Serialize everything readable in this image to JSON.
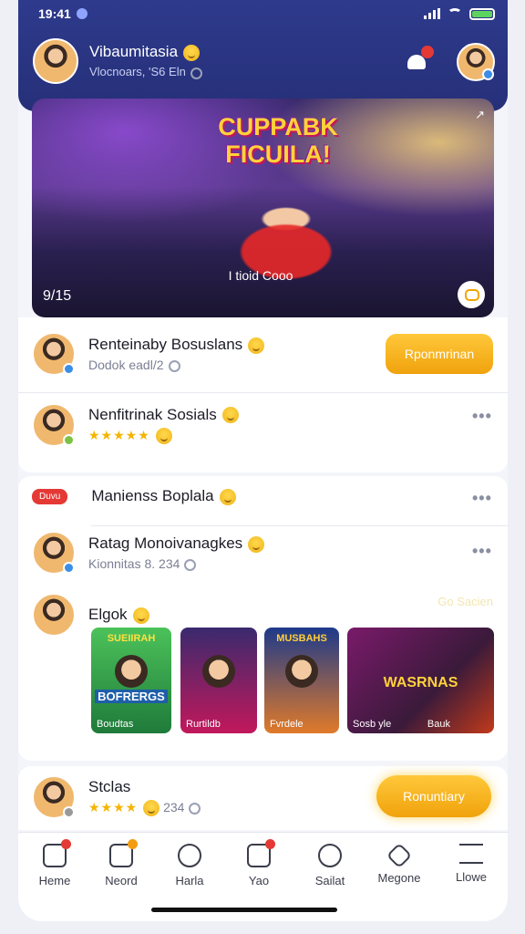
{
  "status_bar": {
    "time": "19:41"
  },
  "header": {
    "user_name": "Vibaumitasia",
    "user_sub": "Vlocnoars, 'S6 Eln"
  },
  "hero": {
    "title_line1": "CUPPABK",
    "title_line2": "FICUILA!",
    "center_text": "I tioid Cooo",
    "count": "9/15",
    "expand": "↗"
  },
  "feed": {
    "item1": {
      "title": "Renteinaby Bosuslans",
      "sub": "Dodok eadl/2",
      "button": "Rponmrinan"
    },
    "item2": {
      "title": "Nenfitrinak Sosials",
      "stars": "★★★★★"
    },
    "item3": {
      "tag": "Duvu",
      "title": "Manienss Boplala"
    },
    "item4": {
      "title": "Ratag Monoivanagkes",
      "sub": "Kionnitas 8. 234"
    },
    "item5": {
      "title": "Elgok",
      "muted": "Go Sacien"
    },
    "thumbs": [
      {
        "head": "SUEIIRAH",
        "mid": "BOFRERGS",
        "caption": "Boudtas",
        "bg": "#3aa94a"
      },
      {
        "head": "",
        "mid": "",
        "caption": "Rurtildb",
        "bg": "#5a2a4a"
      },
      {
        "head": "MUSBAHS",
        "mid": "",
        "caption": "Fvrdele",
        "bg": "#2a3a7a"
      },
      {
        "head": "",
        "mid": "WASRNAS",
        "caption": "Sosb yle",
        "bg": "#6a2a6a"
      }
    ],
    "thumb4_extra": "Bauk"
  },
  "bottom_card": {
    "title": "Stclas",
    "stars": "★★★★",
    "count": "234",
    "button": "Ronuntiary"
  },
  "nav": [
    {
      "label": "Heme",
      "icon": "home-icon"
    },
    {
      "label": "Neord",
      "icon": "notes-icon"
    },
    {
      "label": "Harla",
      "icon": "chat-icon"
    },
    {
      "label": "Yao",
      "icon": "card-icon"
    },
    {
      "label": "Sailat",
      "icon": "search-icon"
    },
    {
      "label": "Megone",
      "icon": "star-icon"
    },
    {
      "label": "Llowe",
      "icon": "menu-icon"
    }
  ],
  "colors": {
    "header": "#2e3a8c",
    "accent": "#f0a20c",
    "badge": "#e53935"
  }
}
